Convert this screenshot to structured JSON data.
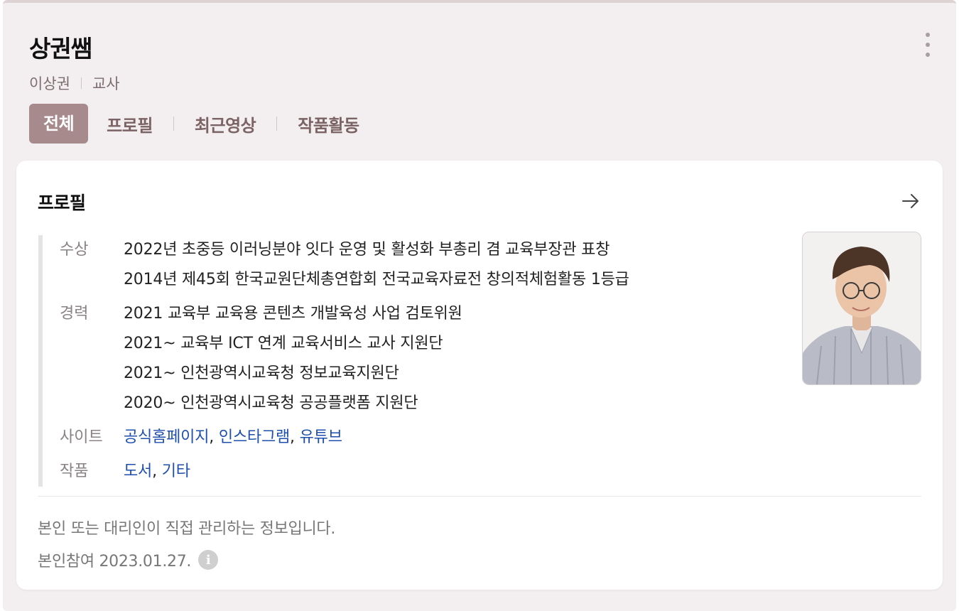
{
  "header": {
    "title": "상권쌤",
    "name": "이상권",
    "role": "교사"
  },
  "tabs": [
    {
      "label": "전체",
      "active": true
    },
    {
      "label": "프로필",
      "active": false
    },
    {
      "label": "최근영상",
      "active": false
    },
    {
      "label": "작품활동",
      "active": false
    }
  ],
  "profile": {
    "title": "프로필",
    "awards_label": "수상",
    "awards": [
      "2022년 초중등 이러닝분야 잇다 운영 및 활성화 부총리 겸 교육부장관 표창",
      "2014년 제45회 한국교원단체총연합회 전국교육자료전 창의적체험활동 1등급"
    ],
    "career_label": "경력",
    "career": [
      "2021 교육부 교육용 콘텐츠 개발육성 사업 검토위원",
      "2021~ 교육부 ICT 연계 교육서비스 교사 지원단",
      "2021~ 인천광역시교육청 정보교육지원단",
      "2020~ 인천광역시교육청 공공플랫폼 지원단"
    ],
    "site_label": "사이트",
    "sites": [
      "공식홈페이지",
      "인스타그램",
      "유튜브"
    ],
    "works_label": "작품",
    "works": [
      "도서",
      "기타"
    ],
    "separator": ", "
  },
  "footer": {
    "notice": "본인 또는 대리인이 직접 관리하는 정보입니다.",
    "joined": "본인참여 2023.01.27.",
    "info_glyph": "i"
  },
  "colors": {
    "accent": "#a68a8c",
    "link": "#1e4fae",
    "background": "#f3eff0"
  },
  "icons": {
    "menu": "more-vertical-icon",
    "arrow": "arrow-right-icon",
    "info": "info-icon"
  }
}
